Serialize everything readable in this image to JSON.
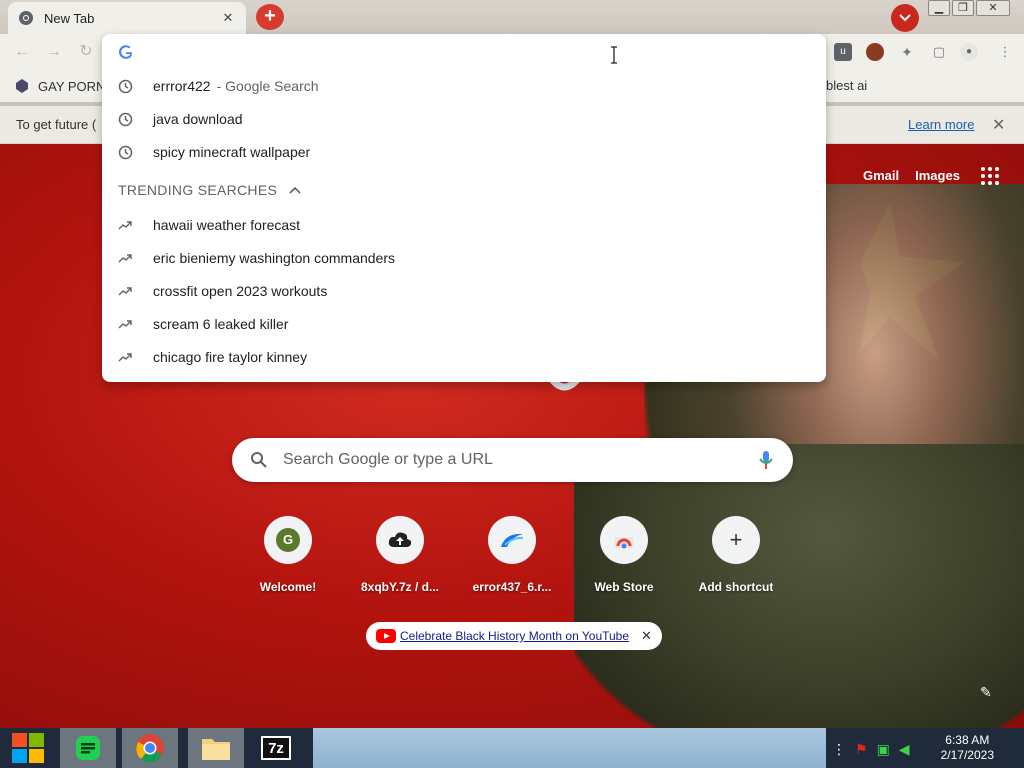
{
  "browser": {
    "tab": {
      "title": "New Tab"
    },
    "tab_close": "✕",
    "new_tab": "+",
    "window_controls": [
      "▁",
      "❐",
      "✕"
    ]
  },
  "omnibox": {
    "value": "",
    "suggestions": [
      {
        "text": "errror422",
        "desc": "- Google Search",
        "icon": "clock-icon"
      },
      {
        "text": "java download",
        "desc": "",
        "icon": "clock-icon"
      },
      {
        "text": "spicy minecraft wallpaper",
        "desc": "",
        "icon": "clock-icon"
      }
    ],
    "trending_header": "TRENDING SEARCHES",
    "trending": [
      "hawaii weather forecast",
      "eric bieniemy washington commanders",
      "crossfit open 2023 workouts",
      "scream 6 leaked killer",
      "chicago fire taylor kinney"
    ]
  },
  "bookmarks": {
    "left": "GAY PORN",
    "right": "blest ai"
  },
  "infobar": {
    "text": "To get future (",
    "learn_more": "Learn more",
    "close": "✕"
  },
  "ntp": {
    "links": {
      "gmail": "Gmail",
      "images": "Images"
    },
    "search_placeholder": "Search Google or type a URL",
    "shortcuts": [
      {
        "label": "Welcome!",
        "icon_letter": "G"
      },
      {
        "label": "8xqbY.7z / d...",
        "icon_letter": ""
      },
      {
        "label": "error437_6.r...",
        "icon_letter": ""
      },
      {
        "label": "Web Store",
        "icon_letter": ""
      },
      {
        "label": "Add shortcut",
        "icon_letter": "+"
      }
    ],
    "promo": "Celebrate Black History Month on YouTube",
    "promo_close": "✕"
  },
  "taskbar": {
    "time": "6:38 AM",
    "date": "2/17/2023",
    "apps": [
      "start",
      "notes",
      "chrome",
      "file-explorer",
      "7zip"
    ],
    "sevenzip_label": "7z"
  },
  "colors": {
    "accent_red": "#d63b2f",
    "background_red": "#b4140f",
    "link_blue": "#1a5fb4"
  }
}
